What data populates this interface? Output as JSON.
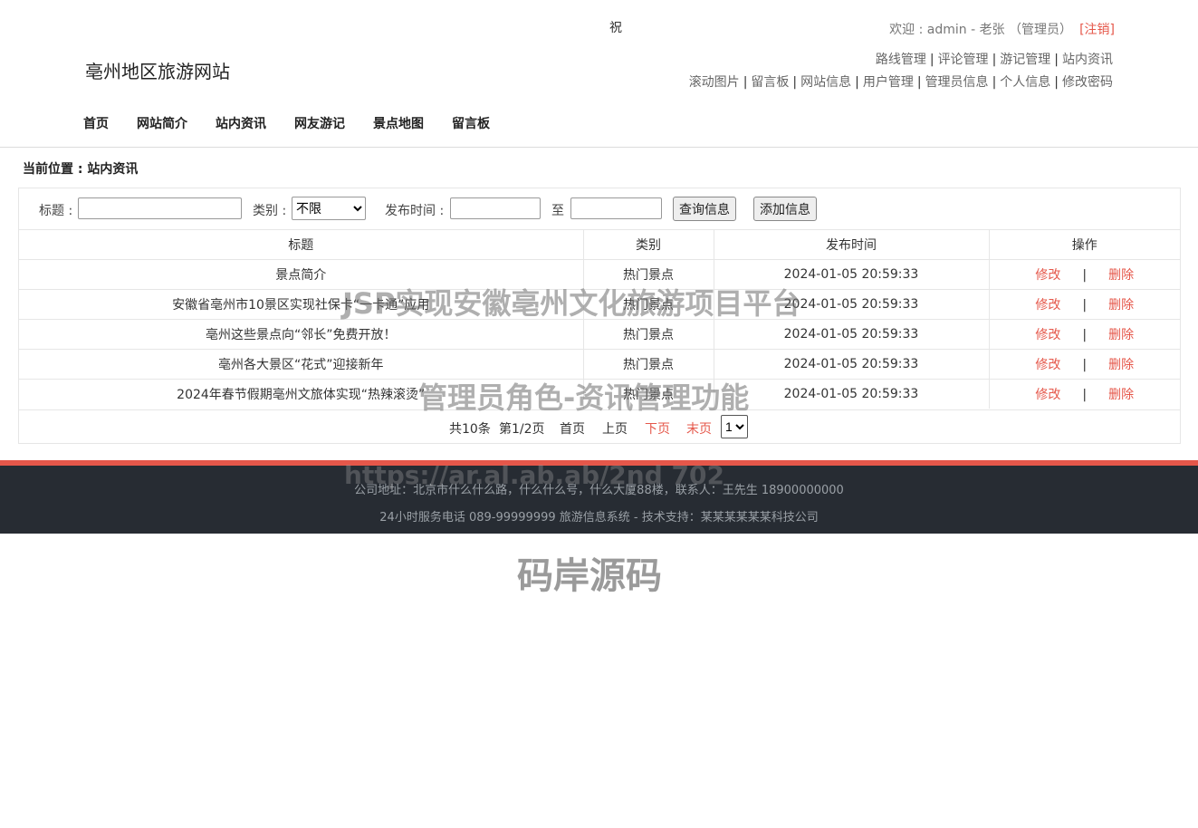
{
  "header": {
    "marquee_text": "祝",
    "site_title": "亳州地区旅游网站",
    "welcome": "欢迎 : admin - 老张 （管理员）",
    "logout": "[注销]",
    "admin_row1": [
      "路线管理",
      "评论管理",
      "游记管理",
      "站内资讯"
    ],
    "admin_row2": [
      "滚动图片",
      "留言板",
      "网站信息",
      "用户管理",
      "管理员信息",
      "个人信息",
      "修改密码"
    ],
    "nav": [
      "首页",
      "网站简介",
      "站内资讯",
      "网友游记",
      "景点地图",
      "留言板"
    ]
  },
  "breadcrumb": "当前位置 : 站内资讯",
  "search": {
    "title_label": "标题 :",
    "title_value": "",
    "category_label": "类别 :",
    "category_selected": "不限",
    "date_label": "发布时间 :",
    "to_label": "至",
    "query_button": "查询信息",
    "add_button": "添加信息"
  },
  "table": {
    "headers": [
      "标题",
      "类别",
      "发布时间",
      "操作"
    ],
    "rows": [
      {
        "title": "景点简介",
        "category": "热门景点",
        "time": "2024-01-05 20:59:33"
      },
      {
        "title": "安徽省亳州市10景区实现社保卡“一卡通”应用",
        "category": "热门景点",
        "time": "2024-01-05 20:59:33"
      },
      {
        "title": "亳州这些景点向“邻长”免费开放！",
        "category": "热门景点",
        "time": "2024-01-05 20:59:33"
      },
      {
        "title": "亳州各大景区“花式”迎接新年",
        "category": "热门景点",
        "time": "2024-01-05 20:59:33"
      },
      {
        "title": "2024年春节假期亳州文旅体实现“热辣滚烫”",
        "category": "热门景点",
        "time": "2024-01-05 20:59:33"
      }
    ],
    "edit_label": "修改",
    "separator": "|",
    "delete_label": "删除"
  },
  "pager": {
    "total": "共10条",
    "page": "第1/2页",
    "first": "首页",
    "prev": "上页",
    "next": "下页",
    "last": "末页",
    "current_page": "1"
  },
  "footer": {
    "line1": "公司地址：北京市什么什么路，什么什么号，什么大厦88楼，联系人：王先生 18900000000",
    "line2": "24小时服务电话    089-99999999    旅游信息系统 - 技术支持：某某某某某某科技公司"
  },
  "watermarks": {
    "line1": "JSP实现安徽亳州文化旅游项目平台",
    "line2": "管理员角色-资讯管理功能",
    "line3": "https://ar.al.ab.ab/2nd 702",
    "line4": "码岸源码"
  },
  "colors": {
    "accent": "#e5574a",
    "footer_bg": "#272c33"
  }
}
